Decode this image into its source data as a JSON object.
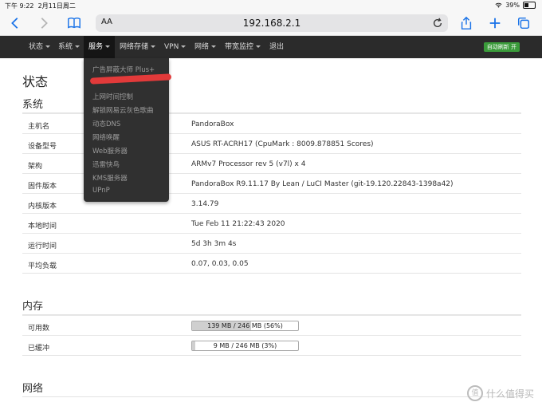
{
  "status_bar": {
    "time": "下午 9:22",
    "date": "2月11日周二",
    "battery": "39%",
    "battery_level": 0.39
  },
  "browser": {
    "aa_label": "AA",
    "url": "192.168.2.1"
  },
  "navbar": {
    "items": [
      "状态",
      "系统",
      "服务",
      "网络存储",
      "VPN",
      "网络",
      "带宽监控",
      "退出"
    ],
    "autorefresh": "自动刷新 开"
  },
  "dropdown": {
    "items": [
      "广告屏蔽大师 Plus+",
      "上网时间控制",
      "解锁网易云灰色歌曲",
      "动态DNS",
      "网络唤醒",
      "Web服务器",
      "迅雷快鸟",
      "KMS服务器",
      "UPnP"
    ]
  },
  "page": {
    "title": "状态"
  },
  "system": {
    "title": "系统",
    "rows": [
      {
        "label": "主机名",
        "value": "PandoraBox"
      },
      {
        "label": "设备型号",
        "value": "ASUS RT-ACRH17 (CpuMark : 8009.878851 Scores)"
      },
      {
        "label": "架构",
        "value": "ARMv7 Processor rev 5 (v7l) x 4"
      },
      {
        "label": "固件版本",
        "value": "PandoraBox R9.11.17 By Lean / LuCI Master (git-19.120.22843-1398a42)"
      },
      {
        "label": "内核版本",
        "value": "3.14.79"
      },
      {
        "label": "本地时间",
        "value": "Tue Feb 11 21:22:43 2020"
      },
      {
        "label": "运行时间",
        "value": "5d 3h 3m 4s"
      },
      {
        "label": "平均负载",
        "value": "0.07, 0.03, 0.05"
      }
    ]
  },
  "memory": {
    "title": "内存",
    "rows": [
      {
        "label": "可用数",
        "value": "139 MB / 246 MB (56%)",
        "percent": 56
      },
      {
        "label": "已缓冲",
        "value": "9 MB / 246 MB (3%)",
        "percent": 3
      }
    ]
  },
  "network": {
    "title": "网络"
  },
  "watermark": {
    "text": "什么值得买",
    "glyph": "值"
  }
}
